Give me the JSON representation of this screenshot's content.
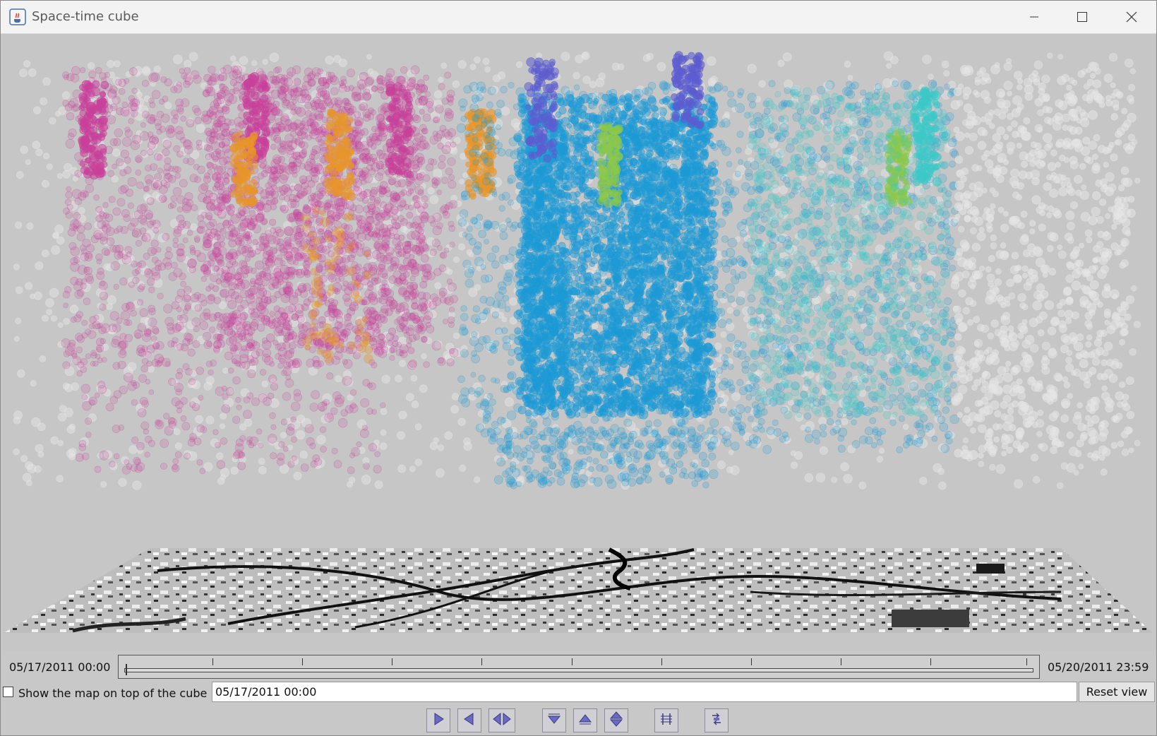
{
  "window": {
    "title": "Space-time cube",
    "icon": "java-cup-icon"
  },
  "controls": {
    "minimize_icon": "minimize-icon",
    "maximize_icon": "maximize-icon",
    "close_icon": "close-icon"
  },
  "timeline": {
    "start_label": "05/17/2011 00:00",
    "end_label": "05/20/2011 23:59",
    "position": 0
  },
  "options": {
    "map_on_top_label": "Show the map on top of the cube",
    "map_on_top_checked": false,
    "current_time": "05/17/2011 00:00",
    "reset_label": "Reset view"
  },
  "toolbar": {
    "buttons": [
      {
        "name": "play-forward-icon"
      },
      {
        "name": "play-backward-icon"
      },
      {
        "name": "play-both-icon"
      },
      {
        "name": "move-down-icon"
      },
      {
        "name": "move-up-icon"
      },
      {
        "name": "move-up-down-icon"
      },
      {
        "name": "time-grid-icon"
      },
      {
        "name": "rotate-view-icon"
      }
    ]
  },
  "colors": {
    "cluster_magenta": "#c8409a",
    "cluster_orange": "#e8962a",
    "cluster_blue": "#1b9ad6",
    "cluster_indigo": "#5c5cd0",
    "cluster_green": "#8cc84a",
    "cluster_cyan": "#3cc8c8",
    "noise_gray": "#e6e6e6"
  }
}
